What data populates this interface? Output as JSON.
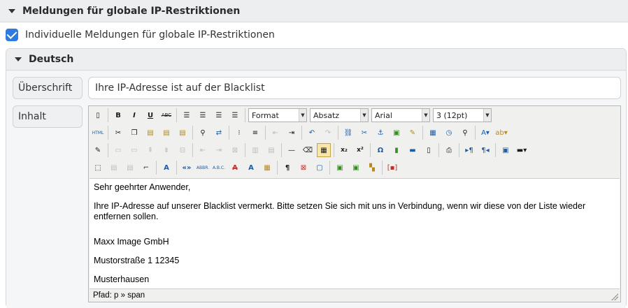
{
  "section": {
    "title": "Meldungen für globale IP-Restriktionen"
  },
  "checkbox": {
    "label": "Individuelle Meldungen für globale IP-Restriktionen",
    "checked": true
  },
  "language": {
    "title": "Deutsch"
  },
  "fields": {
    "heading_label": "Überschrift",
    "heading_value": "Ihre IP-Adresse ist auf der Blacklist",
    "content_label": "Inhalt"
  },
  "editor": {
    "selects": {
      "format": "Format",
      "block": "Absatz",
      "font": "Arial",
      "size": "3 (12pt)"
    },
    "buttons": {
      "bold": "B",
      "italic": "I",
      "underline": "U",
      "strike": "ABC",
      "html": "HTML",
      "abbr": "ABBR.",
      "acronym": "A.B.C.",
      "quote": "«»",
      "omega": "Ω",
      "pilcrow": "¶",
      "sub": "x₂",
      "sup": "x²"
    },
    "content": [
      "Sehr geehrter Anwender,",
      "Ihre IP-Adresse auf unserer Blacklist vermerkt. Bitte setzen Sie sich mit uns in Verbindung, wenn wir diese von der Liste wieder entfernen sollen.",
      "Maxx Image GmbH",
      "Mustorstraße 1 12345",
      "Musterhausen"
    ],
    "status_path": "Pfad: p » span"
  },
  "colors": {
    "checkbox": "#2d7be0",
    "header_bg": "#eceef0",
    "editor_bg": "#f0f0ee"
  }
}
